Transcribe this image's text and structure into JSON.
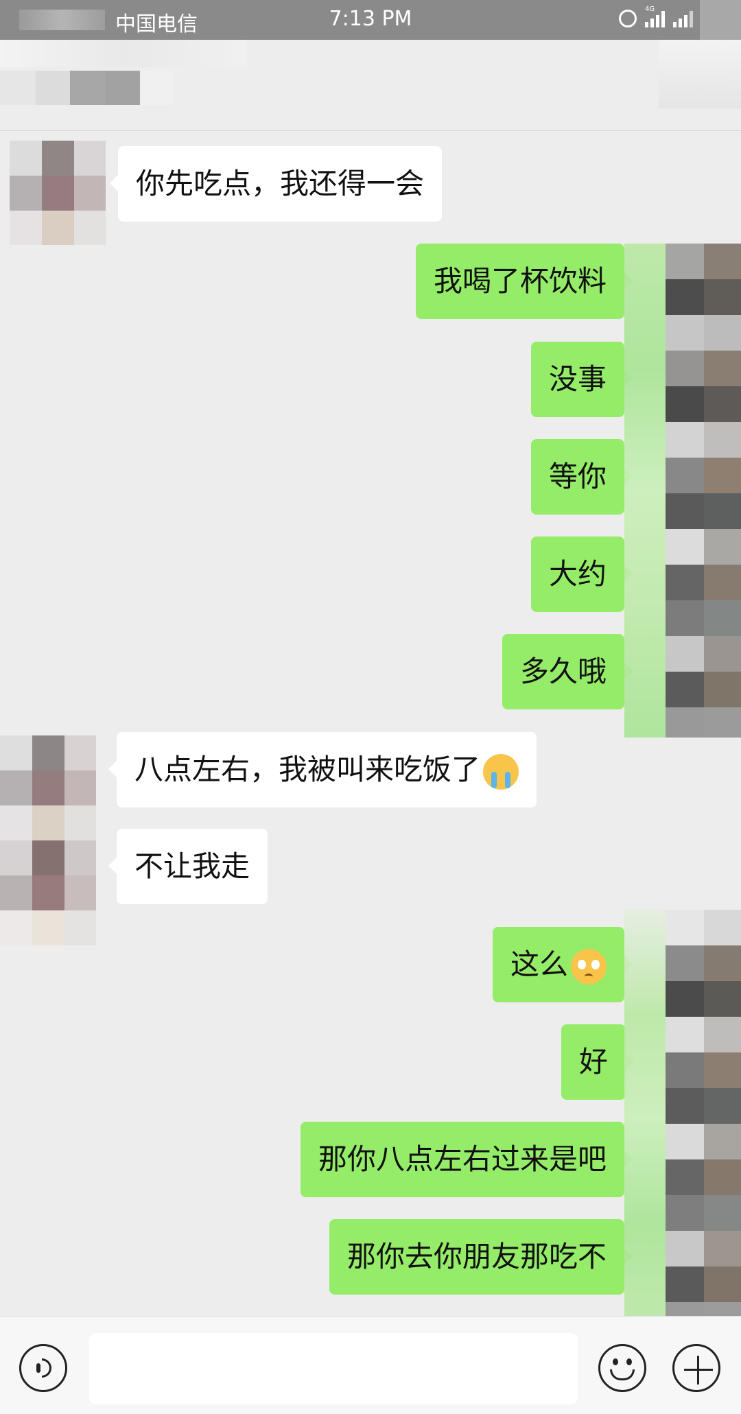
{
  "status_bar": {
    "carrier": "中国电信",
    "time": "7:13 PM",
    "network": "4G"
  },
  "messages": [
    {
      "side": "in",
      "text": "你先吃点，我还得一会"
    },
    {
      "side": "out",
      "text": "我喝了杯饮料"
    },
    {
      "side": "out",
      "text": "没事"
    },
    {
      "side": "out",
      "text": "等你"
    },
    {
      "side": "out",
      "text": "大约"
    },
    {
      "side": "out",
      "text": "多久哦"
    },
    {
      "side": "in",
      "text": "八点左右，我被叫来吃饭了",
      "emoji": "crying-face"
    },
    {
      "side": "in",
      "text": "不让我走"
    },
    {
      "side": "out",
      "text": "这么",
      "emoji": "pleading-face"
    },
    {
      "side": "out",
      "text": "好"
    },
    {
      "side": "out",
      "text": "那你八点左右过来是吧"
    },
    {
      "side": "out",
      "text": "那你去你朋友那吃不"
    }
  ],
  "input_bar": {
    "value": "",
    "placeholder": ""
  },
  "colors": {
    "outgoing_bubble": "#95ec69",
    "incoming_bubble": "#ffffff",
    "background": "#ededed"
  }
}
